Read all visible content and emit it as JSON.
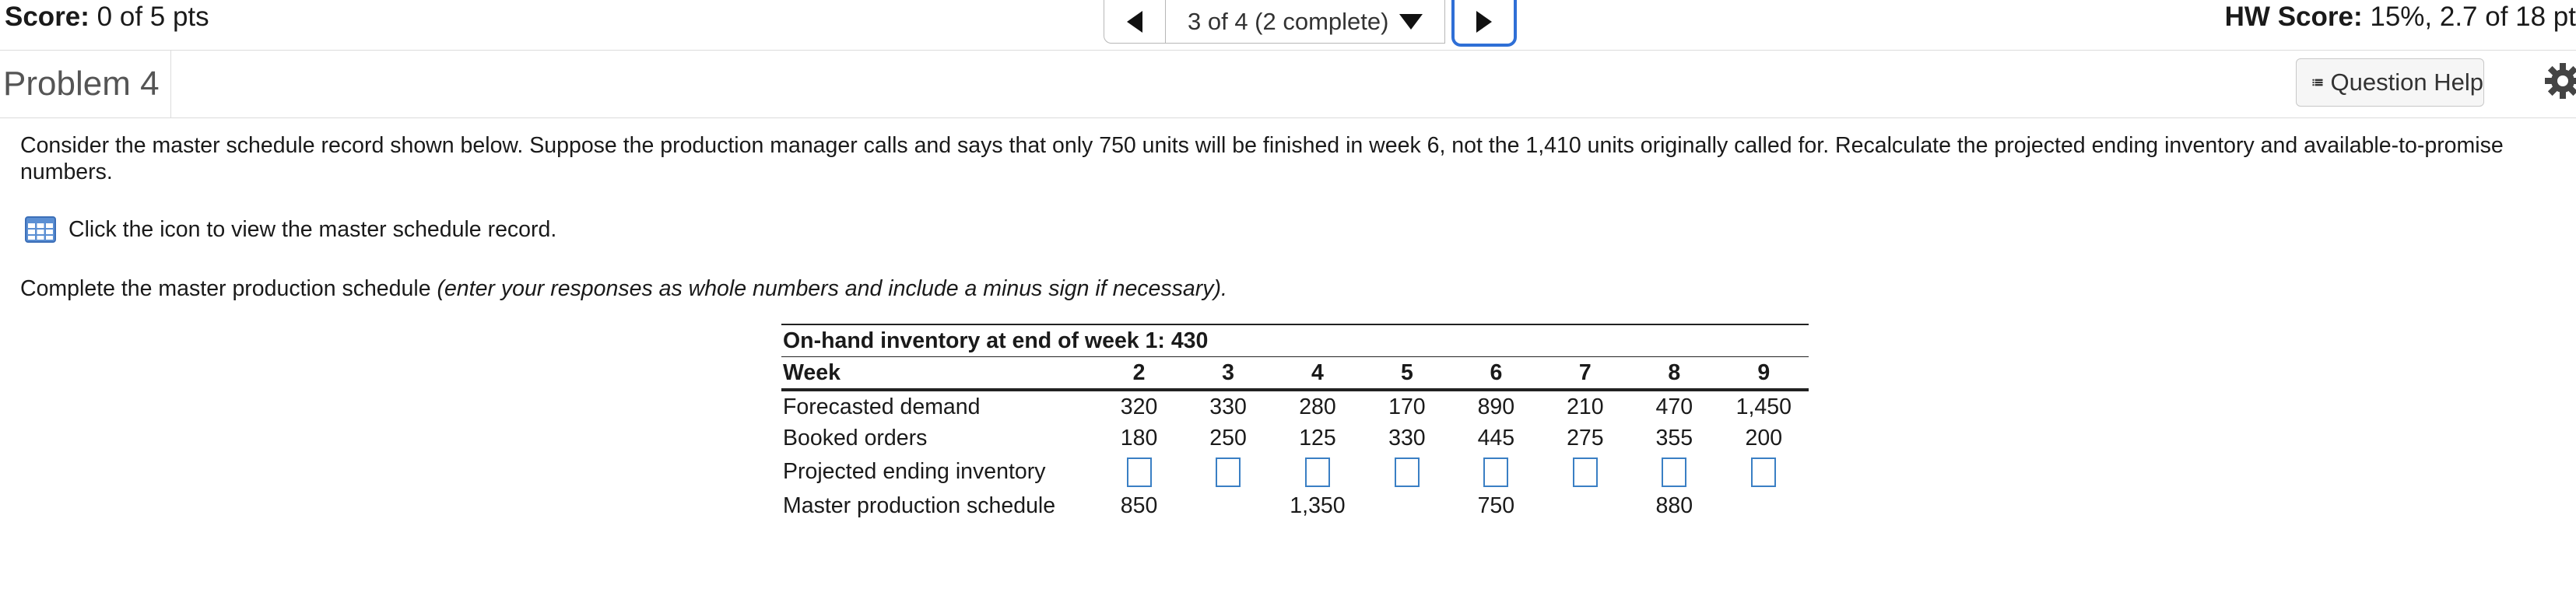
{
  "header": {
    "score_label": "Score:",
    "score_value": "0 of 5 pts",
    "question_count": "3 of 4 (2 complete)",
    "hw_score_label": "HW Score:",
    "hw_score_value": "15%, 2.7 of 18 pt"
  },
  "problem": {
    "title": "Problem 4",
    "help_label": "Question Help"
  },
  "content": {
    "intro": "Consider the master schedule record shown below. Suppose the production manager calls and says that only 750 units will be finished in week 6, not the 1,410 units originally called for. Recalculate the projected ending inventory and available-to-promise numbers.",
    "icon_text": "Click the icon to view the master schedule record.",
    "instruction": "Complete the master production schedule",
    "instruction_italic": "(enter your responses as whole numbers and include a minus sign if necessary)."
  },
  "table": {
    "on_hand": "On-hand inventory at end of week 1: 430",
    "week_label": "Week",
    "weeks": [
      "2",
      "3",
      "4",
      "5",
      "6",
      "7",
      "8",
      "9"
    ],
    "forecast_label": "Forecasted demand",
    "forecast": [
      "320",
      "330",
      "280",
      "170",
      "890",
      "210",
      "470",
      "1,450"
    ],
    "booked_label": "Booked orders",
    "booked": [
      "180",
      "250",
      "125",
      "330",
      "445",
      "275",
      "355",
      "200"
    ],
    "pei_label": "Projected ending inventory",
    "pei": [
      "",
      "",
      "",
      "",
      "",
      "",
      "",
      ""
    ],
    "mps_label": "Master production schedule",
    "mps": [
      "850",
      "",
      "1,350",
      "",
      "750",
      "",
      "880",
      ""
    ]
  }
}
